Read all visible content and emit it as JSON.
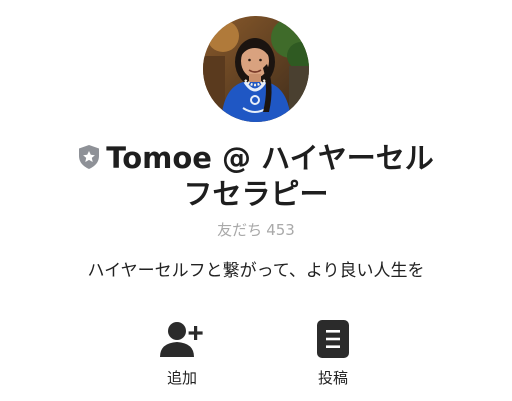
{
  "profile": {
    "name_line1": "Tomoe @ ハイヤーセル",
    "name_line2": "フセラピー",
    "friends_label": "友だち",
    "friends_count": "453",
    "description": "ハイヤーセルフと繋がって、より良い人生を"
  },
  "actions": [
    {
      "label": "追加",
      "icon": "add-friend-icon"
    },
    {
      "label": "投稿",
      "icon": "posts-icon"
    }
  ],
  "colors": {
    "text": "#1e1e1e",
    "muted": "#a9a9a9",
    "icon": "#2b2b2b",
    "badge": "#8e9197"
  }
}
